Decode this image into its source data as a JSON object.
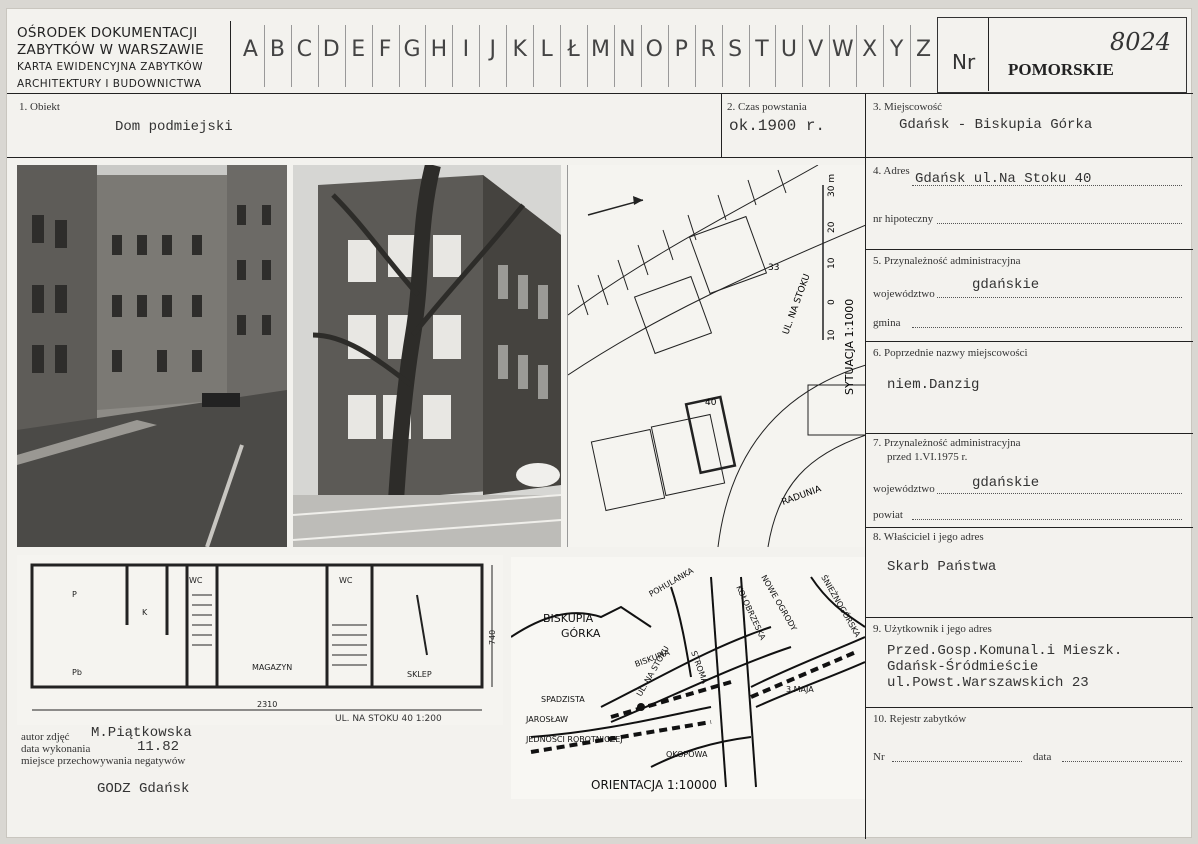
{
  "header": {
    "institution_lines": [
      "OŚRODEK DOKUMENTACJI",
      "ZABYTKÓW W WARSZAWIE"
    ],
    "card_lines": [
      "KARTA EWIDENCYJNA ZABYTKÓW",
      "ARCHITEKTURY I BUDOWNICTWA"
    ],
    "letters": [
      "A",
      "B",
      "C",
      "D",
      "E",
      "F",
      "G",
      "H",
      "I",
      "J",
      "K",
      "L",
      "Ł",
      "M",
      "N",
      "O",
      "P",
      "R",
      "S",
      "T",
      "U",
      "V",
      "W",
      "X",
      "Y",
      "Z"
    ],
    "nr_label": "Nr",
    "region": "POMORSKIE",
    "number": "8024"
  },
  "fields": {
    "object": {
      "label": "1. Obiekt",
      "value": "Dom podmiejski"
    },
    "date": {
      "label": "2. Czas powstania",
      "value": "ok.1900 r."
    },
    "place": {
      "label": "3. Miejscowość",
      "value": "Gdańsk - Biskupia Górka"
    },
    "address": {
      "label": "4. Adres",
      "value": "Gdańsk ul.Na Stoku 40"
    },
    "mortgage": {
      "label": "nr hipoteczny"
    },
    "admin": {
      "label": "5. Przynależność administracyjna",
      "voivodeship_label": "województwo",
      "voivodeship": "gdańskie",
      "commune_label": "gmina"
    },
    "former_names": {
      "label": "6. Poprzednie nazwy miejscowości",
      "value": "niem.Danzig"
    },
    "admin_before": {
      "label_1": "7. Przynależność administracyjna",
      "label_2": "przed 1.VI.1975 r.",
      "voivodeship_label": "województwo",
      "voivodeship": "gdańskie",
      "district_label": "powiat"
    },
    "owner": {
      "label": "8. Właściciel i jego adres",
      "value": "Skarb Państwa"
    },
    "user": {
      "label": "9. Użytkownik i jego adres",
      "lines": [
        "Przed.Gosp.Komunal.i Mieszk.",
        "Gdańsk-Śródmieście",
        "ul.Powst.Warszawskich 23"
      ]
    },
    "registry": {
      "label": "10. Rejestr zabytków",
      "nr_label": "Nr",
      "date_label": "data"
    }
  },
  "photo_meta": {
    "author_label": "autor zdjęć",
    "author": "M.Piątkowska",
    "date_label": "data wykonania",
    "date": "11.82",
    "storage_label": "miejsce przechowywania negatywów",
    "storage": "GODZ Gdańsk"
  },
  "site_plan": {
    "number": "33",
    "number_2": "40",
    "street": "UL. NA STOKU",
    "street_2": "RADUNIA",
    "scale": "SYTUACJA 1:1000",
    "scale_ticks": [
      "30 m",
      "20",
      "10",
      "0",
      "10"
    ]
  },
  "floor_plan": {
    "rooms": [
      "P",
      "K",
      "WC",
      "WC",
      "Pb",
      "MAGAZYN",
      "SKLEP"
    ],
    "width_dim": "2310",
    "depth_dim": "740",
    "caption": "UL. NA STOKU 40    1:200"
  },
  "orientation_map": {
    "labels": [
      "BISKUPIA",
      "GÓRKA",
      "POHULANKA",
      "BISKUPIA",
      "UL. NA STOKU",
      "STROMA",
      "SPADZISTA",
      "JAROSŁAW",
      "JEDNOŚCI ROBOTNICZEJ",
      "OKOPOWA",
      "3 MAJA",
      "ŚNIEŻNOGÓRSKA",
      "NOWE OGRODY",
      "KOŁOBRZESKA"
    ],
    "caption": "ORIENTACJA 1:10000"
  }
}
